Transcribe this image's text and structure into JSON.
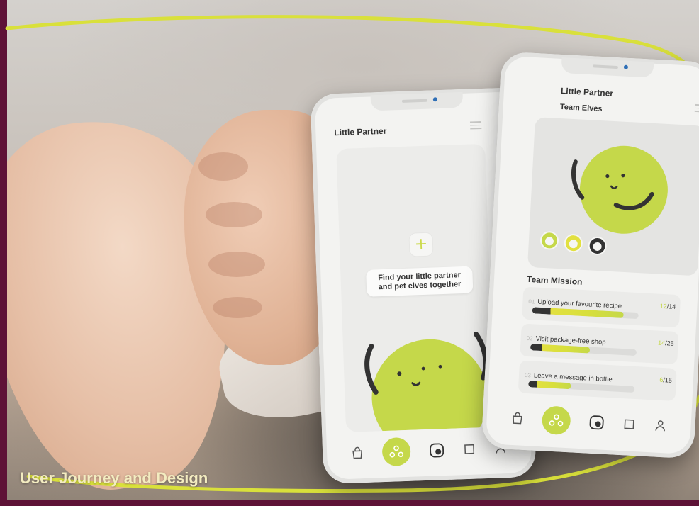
{
  "caption": "User Journey and Design",
  "colors": {
    "accent": "#c5d84a",
    "frame": "#5e1237",
    "loop": "#d9e03b",
    "dark": "#333333"
  },
  "phone_left": {
    "title": "Little Partner",
    "prompt": "Find your little partner\nand pet elves together",
    "add_icon": "plus-icon",
    "nav": [
      "bag-icon",
      "team-icon",
      "face-icon",
      "note-icon",
      "profile-icon"
    ]
  },
  "phone_right": {
    "title": "Little Partner",
    "subtitle": "Team Elves",
    "mission_heading": "Team Mission",
    "missions": [
      {
        "num": "01",
        "name": "Upload your favourite recipe",
        "done": "12",
        "total": "/14",
        "progress": 0.86
      },
      {
        "num": "02",
        "name": "Visit package-free shop",
        "done": "14",
        "total": "/25",
        "progress": 0.56
      },
      {
        "num": "03",
        "name": "Leave a message in bottle",
        "done": "6",
        "total": "/15",
        "progress": 0.4
      }
    ],
    "nav": [
      "bag-icon",
      "team-icon",
      "face-icon",
      "note-icon",
      "profile-icon"
    ]
  }
}
